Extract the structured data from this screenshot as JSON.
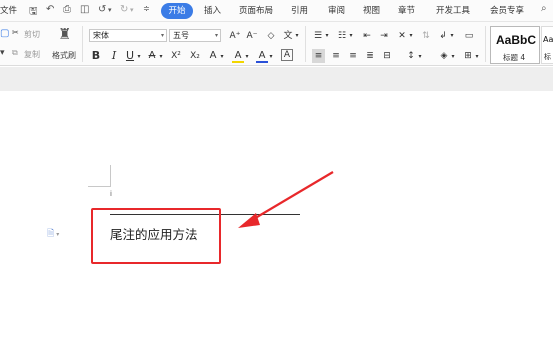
{
  "menubar": {
    "file_label": "文件",
    "tabs": [
      {
        "label": "开始"
      },
      {
        "label": "插入"
      },
      {
        "label": "页面布局"
      },
      {
        "label": "引用"
      },
      {
        "label": "审阅"
      },
      {
        "label": "视图"
      },
      {
        "label": "章节"
      },
      {
        "label": "开发工具"
      },
      {
        "label": "会员专享"
      }
    ],
    "quick_access_icons": [
      "save-icon",
      "undo-icon",
      "print-icon",
      "print-preview-icon",
      "undo-arrow-icon",
      "redo-arrow-icon",
      "customize-icon"
    ],
    "accent_color": "#3b7ce6"
  },
  "ribbon": {
    "clipboard": {
      "cut_label": "剪切",
      "copy_label": "复制",
      "format_painter_label": "格式刷"
    },
    "font": {
      "family_value": "宋体",
      "size_value": "五号",
      "bold": "B",
      "italic": "I",
      "underline": "U",
      "strikethrough": "A",
      "superscript": "X²",
      "subscript": "X₂",
      "text_effect": "A",
      "highlight": "A",
      "font_color": "A",
      "char_border": "A",
      "grow_font": "A⁺",
      "shrink_font": "A⁻",
      "clear_format": "◇",
      "pinyin": "文"
    },
    "styles": {
      "style1_preview": "AaBbC",
      "style1_name": "标题 4",
      "style2_preview": "Aa",
      "style2_name": "标"
    }
  },
  "document": {
    "cursor_marker": "i",
    "endnote_text": "尾注的应用方法",
    "annotation_color": "#e8282b"
  }
}
